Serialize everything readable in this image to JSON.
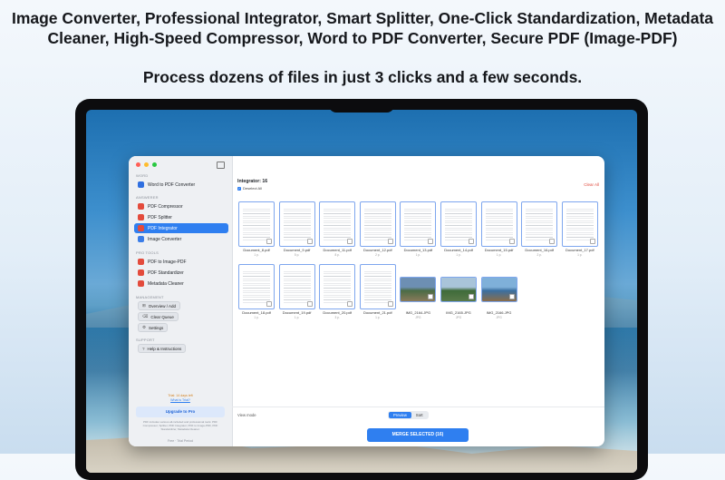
{
  "hero": {
    "headline_line1": "Image Converter, Professional Integrator, Smart Splitter, One-Click Standardization, Metadata",
    "headline_line2": "Cleaner, High-Speed Compressor, Word to PDF Converter, Secure PDF (Image-PDF)",
    "subline": "Process dozens of files in just 3 clicks and a few seconds."
  },
  "sidebar": {
    "sections": [
      {
        "label": "WORD",
        "items": [
          {
            "label": "Word to PDF Converter",
            "icon": "word-doc-icon",
            "color": "#2f6fe0"
          }
        ]
      },
      {
        "label": "ANSWERER",
        "items": [
          {
            "label": "PDF Compressor",
            "icon": "compress-icon",
            "color": "#e34b3c"
          },
          {
            "label": "PDF Splitter",
            "icon": "split-icon",
            "color": "#e34b3c"
          },
          {
            "label": "PDF Integrator",
            "icon": "merge-icon",
            "color": "#e34b3c",
            "active": true
          },
          {
            "label": "Image Converter",
            "icon": "image-icon",
            "color": "#3a7de8"
          }
        ]
      },
      {
        "label": "PRO TOOLS",
        "items": [
          {
            "label": "PDF to Image-PDF",
            "icon": "image-pdf-icon",
            "color": "#e34b3c"
          },
          {
            "label": "PDF Standardizer",
            "icon": "standardize-icon",
            "color": "#e34b3c"
          },
          {
            "label": "Metadata Cleaner",
            "icon": "clean-icon",
            "color": "#e34b3c"
          }
        ]
      }
    ],
    "management_label": "Management",
    "management_buttons": [
      "Overview / Add",
      "Clear Queue",
      "Settings"
    ],
    "support_label": "Support",
    "support_buttons": [
      "Help & Instructions"
    ],
    "trial_notice": "Trial: 14 days left",
    "trial_link": "What is Trial?",
    "upgrade_label": "Upgrade to Pro",
    "fine_print": "PDF includes various all-included and professional tools: PDF Compressor, Splitter, PDF Integrator, PDF to Image-PDF, PDF Standardizer, Metadata Cleaner.",
    "plan_label": "Free · Trial Period"
  },
  "main": {
    "title": "Integrator: 16",
    "deselect_label": "Deselect All",
    "clear_all_label": "Clear All",
    "files": [
      {
        "name": "Document_8.pdf",
        "meta": "1 p.",
        "kind": "doc"
      },
      {
        "name": "Document_9.pdf",
        "meta": "5 p.",
        "kind": "doc"
      },
      {
        "name": "Document_11.pdf",
        "meta": "8 p.",
        "kind": "doc"
      },
      {
        "name": "Document_12.pdf",
        "meta": "2 p.",
        "kind": "doc"
      },
      {
        "name": "Document_13.pdf",
        "meta": "1 p.",
        "kind": "doc"
      },
      {
        "name": "Document_14.pdf",
        "meta": "1 p.",
        "kind": "doc"
      },
      {
        "name": "Document_15.pdf",
        "meta": "1 p.",
        "kind": "doc"
      },
      {
        "name": "Document_16.pdf",
        "meta": "2 p.",
        "kind": "doc"
      },
      {
        "name": "Document_17.pdf",
        "meta": "1 p.",
        "kind": "doc"
      },
      {
        "name": "Document_18.pdf",
        "meta": "1 p.",
        "kind": "doc"
      },
      {
        "name": "Document_19.pdf",
        "meta": "1 p.",
        "kind": "doc"
      },
      {
        "name": "Document_20.pdf",
        "meta": "3 p.",
        "kind": "doc"
      },
      {
        "name": "Document_21.pdf",
        "meta": "1 p.",
        "kind": "doc"
      },
      {
        "name": "IMG_2164.JPG",
        "meta": "JPG",
        "kind": "photo",
        "palette": [
          "#6d8fb3",
          "#4a6b45",
          "#8a7a5a"
        ]
      },
      {
        "name": "IMG_2165.JPG",
        "meta": "JPG",
        "kind": "photo",
        "palette": [
          "#a9c4d9",
          "#3f6b3a",
          "#5a7a4a"
        ]
      },
      {
        "name": "IMG_2166.JPG",
        "meta": "JPG",
        "kind": "photo",
        "palette": [
          "#7fb0d9",
          "#3b6fa0",
          "#8a6d4a"
        ]
      }
    ],
    "view_mode_label": "View mode",
    "view_modes": [
      "Preview",
      "Sort"
    ],
    "active_view_mode": "Preview",
    "merge_button": "MERGE SELECTED (16)"
  },
  "colors": {
    "accent": "#2f7ff0",
    "danger": "#e04b3f"
  }
}
